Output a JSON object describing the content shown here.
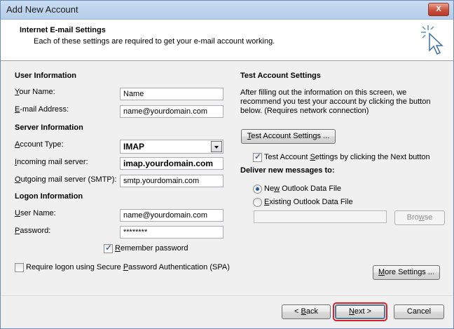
{
  "window": {
    "title": "Add New Account",
    "close_label": "X"
  },
  "header": {
    "title": "Internet E-mail Settings",
    "subtitle": "Each of these settings are required to get your e-mail account working."
  },
  "user_info": {
    "section_label": "User Information",
    "name_label_u": "Y",
    "name_label_rest": "our Name:",
    "name_value": "Name",
    "email_label_u": "E",
    "email_label_rest": "-mail Address:",
    "email_value": "name@yourdomain.com"
  },
  "server_info": {
    "section_label": "Server Information",
    "account_type_label_u": "A",
    "account_type_label_rest": "ccount Type:",
    "account_type_value": "IMAP",
    "incoming_label_u": "I",
    "incoming_label_rest": "ncoming mail server:",
    "incoming_value": "imap.yourdomain.com",
    "outgoing_label_u": "O",
    "outgoing_label_rest": "utgoing mail server (SMTP):",
    "outgoing_value": "smtp.yourdomain.com"
  },
  "logon_info": {
    "section_label": "Logon Information",
    "username_label_u": "U",
    "username_label_rest": "ser Name:",
    "username_value": "name@yourdomain.com",
    "password_label_u": "P",
    "password_label_rest": "assword:",
    "password_value": "********",
    "remember_label_u": "R",
    "remember_label_rest": "emember password",
    "remember_checked": true,
    "spa_label_pre": "Require logon using Secure ",
    "spa_label_u": "P",
    "spa_label_rest": "assword Authentication (SPA)",
    "spa_checked": false
  },
  "test_settings": {
    "section_label": "Test Account Settings",
    "description": "After filling out the information on this screen, we recommend you test your account by clicking the button below. (Requires network connection)",
    "test_button_u": "T",
    "test_button_rest": "est Account Settings ...",
    "auto_test_pre": "Test Account ",
    "auto_test_u": "S",
    "auto_test_rest": "ettings by clicking the Next button",
    "auto_test_checked": true
  },
  "deliver": {
    "section_label": "Deliver new messages to:",
    "new_pst_pre": "Ne",
    "new_pst_u": "w",
    "new_pst_rest": " Outlook Data File",
    "existing_pst_u": "E",
    "existing_pst_rest": "xisting Outlook Data File",
    "selected": "new",
    "browse_label_pre": "Bro",
    "browse_label_u": "w",
    "browse_label_rest": "se"
  },
  "buttons": {
    "more_settings_u": "M",
    "more_settings_rest": "ore Settings ...",
    "back_pre": "< ",
    "back_u": "B",
    "back_rest": "ack",
    "next_pre": "",
    "next_u": "N",
    "next_rest": "ext >",
    "cancel": "Cancel"
  },
  "colors": {
    "titlebar": "#c9dcf2",
    "highlight": "#d2232a",
    "close": "#c9513c"
  }
}
